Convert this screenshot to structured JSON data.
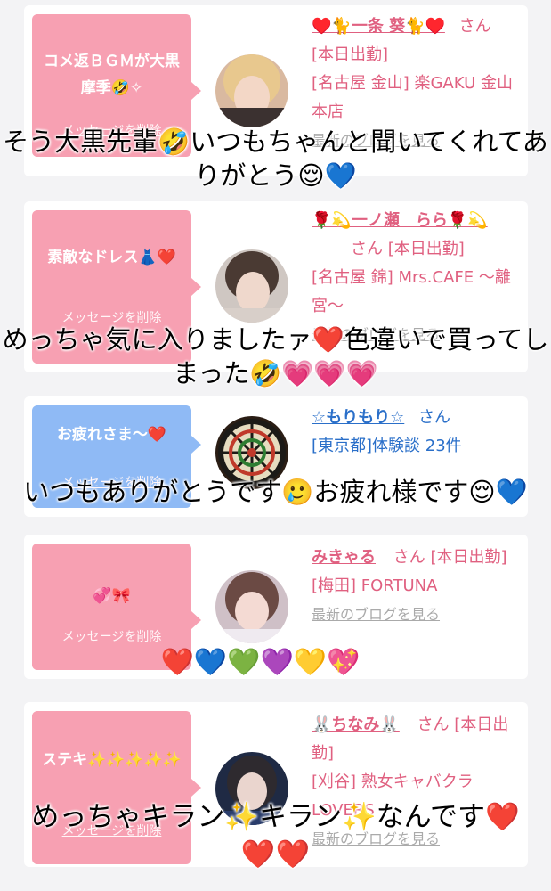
{
  "cards": [
    {
      "bubble_text": "コメ返ＢＧＭが大黒摩季🤣✧",
      "delete_label": "メッセージを削除",
      "name": "♥️🐈一条 葵🐈♥️",
      "san": "さん",
      "status": "[本日出勤]",
      "shop": "[名古屋 金山] 楽GAKU 金山本店",
      "blog": "最新のブログを見る",
      "caption": "そう大黒先輩🤣いつもちゃんと聞いてくれてありがとう😌💙"
    },
    {
      "bubble_text": "素敵なドレス👗❤️",
      "delete_label": "メッセージを削除",
      "name": "🌹💫一ノ瀬　らら🌹💫",
      "san": "さん",
      "status": "[本日出勤]",
      "shop": "[名古屋 錦] Mrs.CAFE ～離宮～",
      "blog": "最新のブログを見る",
      "caption": "めっちゃ気に入りましたァ❤️色違いで買ってしまった🤣💗💗💗"
    },
    {
      "bubble_text": "お疲れさま〜❤️",
      "delete_label": "メッセージを削除",
      "name": "☆もりもり☆",
      "san": "さん",
      "status": "",
      "shop": "[東京都]体験談 23件",
      "blog": "",
      "caption": "いつもありがとうです🥲お疲れ様です😌💙"
    },
    {
      "bubble_text": "💞🎀",
      "delete_label": "メッセージを削除",
      "name": "みきゃる",
      "san": "さん",
      "status": "[本日出勤]",
      "shop": "[梅田] FORTUNA",
      "blog": "最新のブログを見る",
      "caption": "❤️💙💚💜💛💖"
    },
    {
      "bubble_text": "ステキ✨✨✨✨✨",
      "delete_label": "メッセージを削除",
      "name": "🐰ちなみ🐰",
      "san": "さん",
      "status": "[本日出勤]",
      "shop": "[刈谷] 熟女キャバクラ LOVERS",
      "blog": "最新のブログを見る",
      "caption": "めっちゃキラン✨キラン✨なんです❤️❤️❤️"
    }
  ]
}
